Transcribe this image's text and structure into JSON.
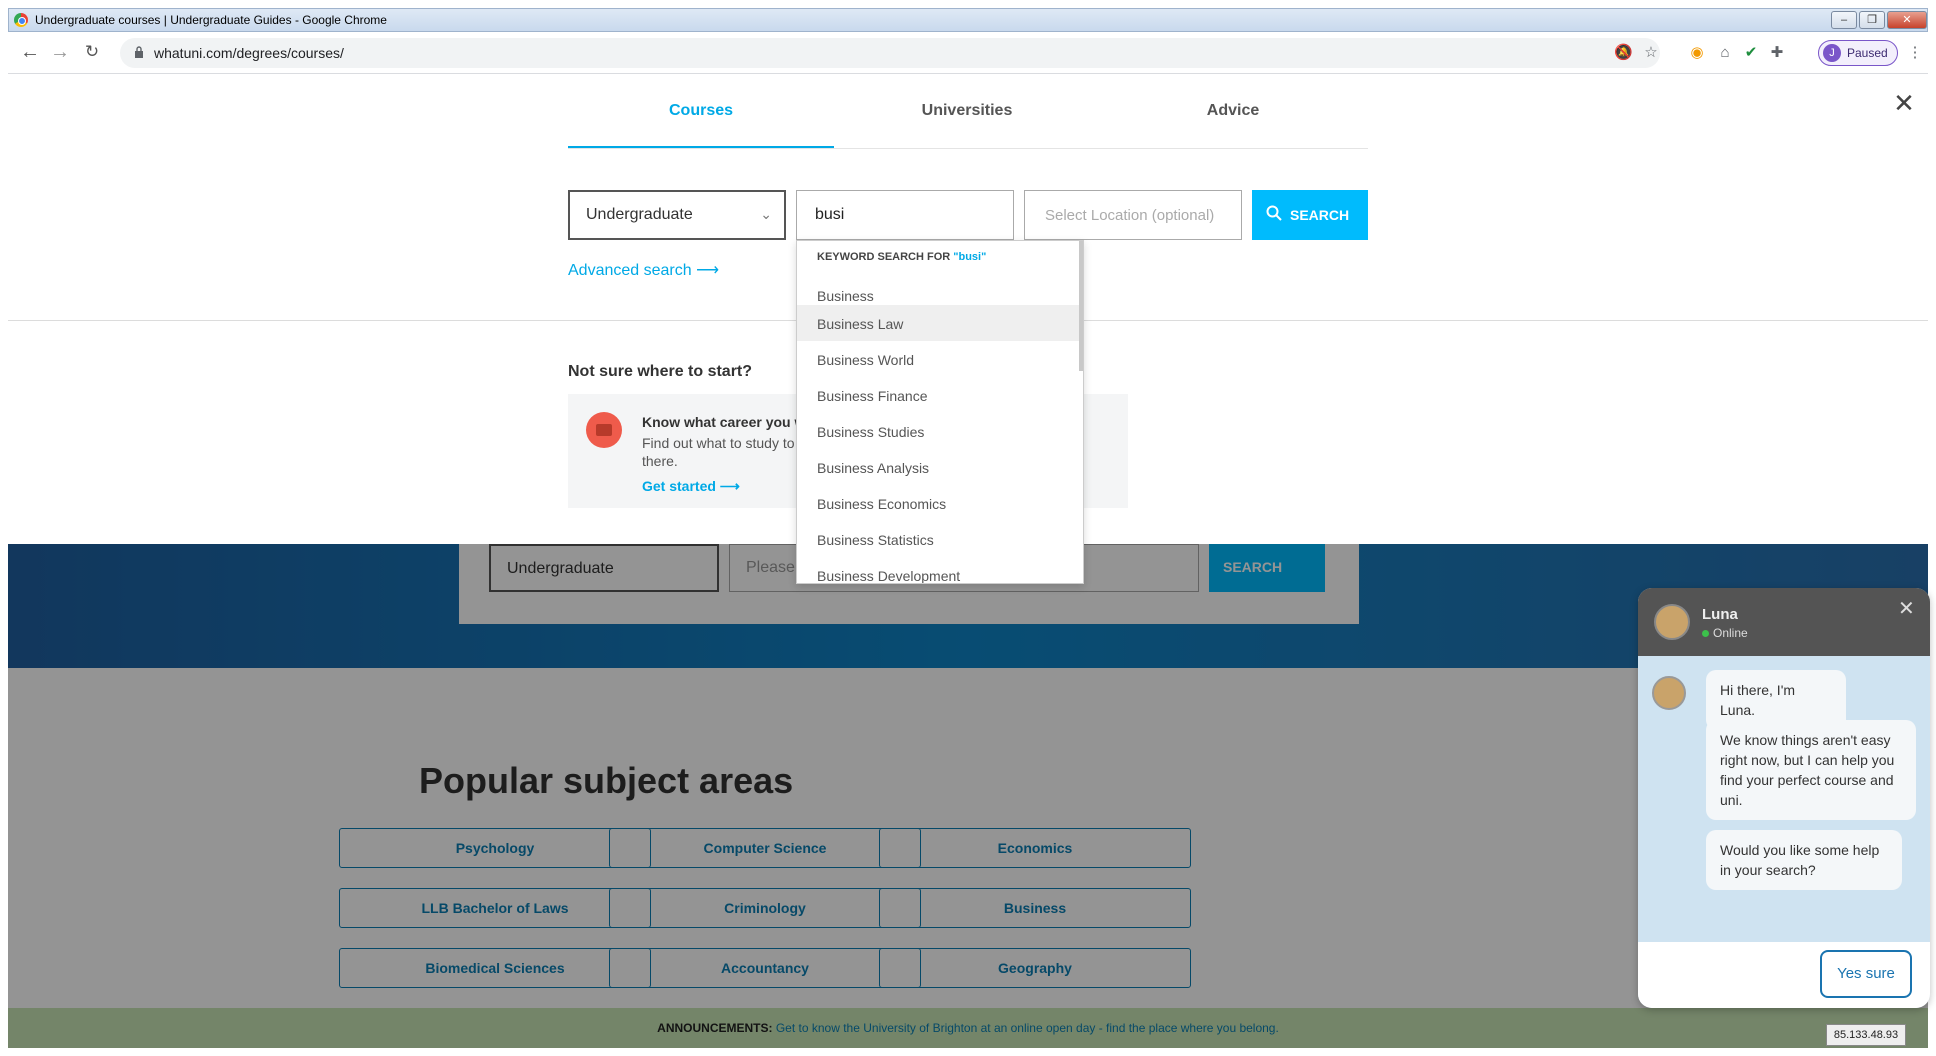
{
  "window": {
    "title": "Undergraduate courses | Undergraduate Guides - Google Chrome"
  },
  "browser": {
    "url": "whatuni.com/degrees/courses/",
    "profile_initial": "J",
    "profile_status": "Paused"
  },
  "overlay": {
    "tabs": [
      "Courses",
      "Universities",
      "Advice"
    ],
    "active_tab": "Courses",
    "qualification": "Undergraduate",
    "keyword_value": "busi",
    "location_placeholder": "Select Location (optional)",
    "search_label": "SEARCH",
    "advanced_search": "Advanced search",
    "not_sure": "Not sure where to start?",
    "career_card": {
      "heading": "Know what career you w",
      "text": "Find out what to study to there.",
      "cta": "Get started"
    }
  },
  "dropdown": {
    "header_prefix": "KEYWORD SEARCH FOR ",
    "header_term": "\"busi\"",
    "items": [
      "Business",
      "Business Law",
      "Business World",
      "Business Finance",
      "Business Studies",
      "Business Analysis",
      "Business Economics",
      "Business Statistics",
      "Business Development"
    ],
    "hovered_item": "Business Law"
  },
  "background_page": {
    "hero_qualification": "Undergraduate",
    "hero_placeholder": "Please",
    "hero_search": "SEARCH",
    "popular_title": "Popular subject areas",
    "subjects": [
      "Psychology",
      "Computer Science",
      "Economics",
      "LLB Bachelor of Laws",
      "Criminology",
      "Business",
      "Biomedical Sciences",
      "Accountancy",
      "Geography"
    ],
    "announcement_label": "ANNOUNCEMENTS:",
    "announcement_text": "Get to know the University of Brighton at an online open day - find the place where you belong."
  },
  "chat": {
    "name": "Luna",
    "status": "Online",
    "messages": [
      "Hi there, I'm Luna.",
      "We know things aren't easy right now, but I can help you find your perfect course and uni.",
      "Would you like some help in your search?"
    ],
    "reply_button": "Yes sure"
  },
  "ip_badge": "85.133.48.93",
  "colors": {
    "accent": "#00bbfd",
    "link": "#00a9e6",
    "subject_border": "#0c7fb3"
  }
}
